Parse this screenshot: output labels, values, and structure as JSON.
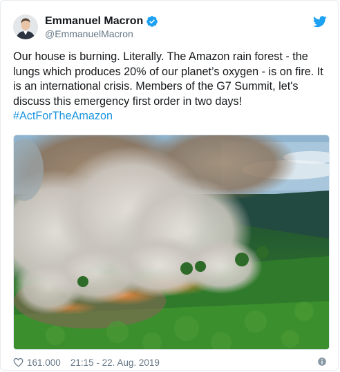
{
  "author": {
    "name": "Emmanuel Macron",
    "handle": "@EmmanuelMacron",
    "verified": true
  },
  "tweet": {
    "text": "Our house is burning. Literally. The Amazon rain forest - the lungs which produces 20% of our planet’s oxygen - is on fire. It is an international crisis. Members of the G7 Summit, let's discuss this emergency first order in two days!",
    "hashtag": "#ActForTheAmazon"
  },
  "footer": {
    "likes": "161.000",
    "timestamp": "21:15 - 22. Aug. 2019"
  },
  "icons": {
    "brand": "twitter-bird-icon",
    "verified": "verified-badge-icon",
    "like": "heart-icon",
    "info": "info-icon"
  },
  "colors": {
    "twitter_blue": "#1da1f2",
    "hashtag": "#1b95e0",
    "secondary_text": "#657786"
  }
}
